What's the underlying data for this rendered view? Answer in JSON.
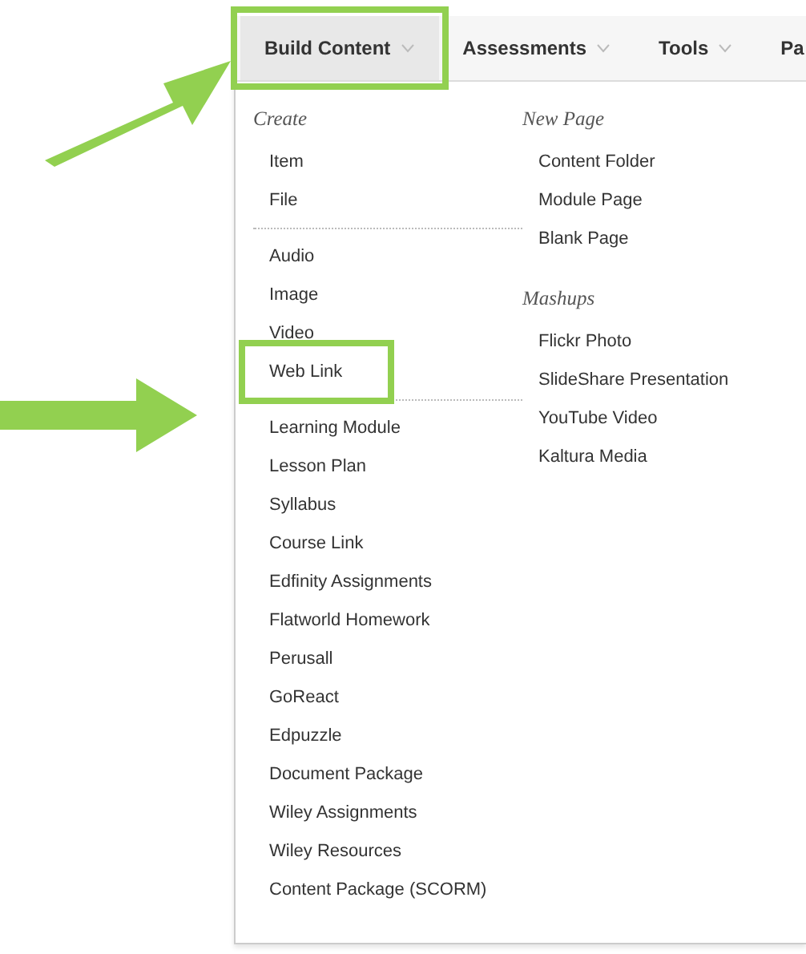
{
  "menubar": {
    "tabs": [
      {
        "label": "Build Content",
        "selected": true,
        "highlighted": true
      },
      {
        "label": "Assessments",
        "selected": false,
        "highlighted": false
      },
      {
        "label": "Tools",
        "selected": false,
        "highlighted": false
      },
      {
        "label": "Pa",
        "selected": false,
        "highlighted": false
      }
    ]
  },
  "dropdown": {
    "columns": [
      {
        "sections": [
          {
            "heading": "Create",
            "groups": [
              [
                {
                  "label": "Item",
                  "highlighted": false
                },
                {
                  "label": "File",
                  "highlighted": false
                }
              ],
              [
                {
                  "label": "Audio",
                  "highlighted": false
                },
                {
                  "label": "Image",
                  "highlighted": false
                },
                {
                  "label": "Video",
                  "highlighted": false
                },
                {
                  "label": "Web Link",
                  "highlighted": true
                }
              ],
              [
                {
                  "label": "Learning Module",
                  "highlighted": false
                },
                {
                  "label": "Lesson Plan",
                  "highlighted": false
                },
                {
                  "label": "Syllabus",
                  "highlighted": false
                },
                {
                  "label": "Course Link",
                  "highlighted": false
                },
                {
                  "label": "Edfinity Assignments",
                  "highlighted": false
                },
                {
                  "label": "Flatworld Homework",
                  "highlighted": false
                },
                {
                  "label": "Perusall",
                  "highlighted": false
                },
                {
                  "label": "GoReact",
                  "highlighted": false
                },
                {
                  "label": "Edpuzzle",
                  "highlighted": false
                },
                {
                  "label": "Document Package",
                  "highlighted": false
                },
                {
                  "label": "Wiley Assignments",
                  "highlighted": false
                },
                {
                  "label": "Wiley Resources",
                  "highlighted": false
                },
                {
                  "label": "Content Package (SCORM)",
                  "highlighted": false
                }
              ]
            ]
          }
        ]
      },
      {
        "sections": [
          {
            "heading": "New Page",
            "groups": [
              [
                {
                  "label": "Content Folder",
                  "highlighted": false
                },
                {
                  "label": "Module Page",
                  "highlighted": false
                },
                {
                  "label": "Blank Page",
                  "highlighted": false
                }
              ]
            ]
          },
          {
            "heading": "Mashups",
            "groups": [
              [
                {
                  "label": "Flickr Photo",
                  "highlighted": false
                },
                {
                  "label": "SlideShare Presentation",
                  "highlighted": false
                },
                {
                  "label": "YouTube Video",
                  "highlighted": false
                },
                {
                  "label": "Kaltura Media",
                  "highlighted": false
                }
              ]
            ]
          }
        ]
      }
    ]
  }
}
